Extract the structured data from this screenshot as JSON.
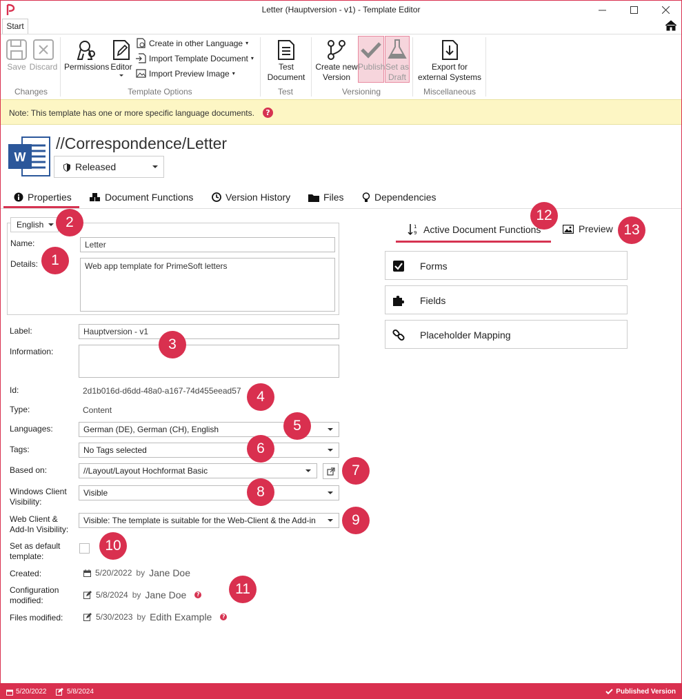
{
  "window": {
    "title": "Letter (Hauptversion - v1) - Template Editor",
    "minimize": "—",
    "maximize": "☐",
    "close": "✕"
  },
  "ribbon": {
    "tab_start": "Start",
    "save": "Save",
    "discard": "Discard",
    "group_changes": "Changes",
    "permissions": "Permissions",
    "editor": "Editor",
    "create_other_language": "Create in other Language",
    "import_template_document": "Import Template Document",
    "import_preview_image": "Import Preview Image",
    "group_template_options": "Template Options",
    "test_document_line1": "Test",
    "test_document_line2": "Document",
    "group_test": "Test",
    "create_new_version_line1": "Create new",
    "create_new_version_line2": "Version",
    "publish": "Publish",
    "set_as_draft_line1": "Set as",
    "set_as_draft_line2": "Draft",
    "group_versioning": "Versioning",
    "export_line1": "Export for",
    "export_line2": "external Systems",
    "group_misc": "Miscellaneous"
  },
  "note": {
    "text": "Note: This template has one or more specific language documents.",
    "help": "?"
  },
  "header": {
    "path": "//Correspondence/Letter",
    "status": "Released"
  },
  "tabs": {
    "properties": "Properties",
    "document_functions": "Document Functions",
    "version_history": "Version History",
    "files": "Files",
    "dependencies": "Dependencies"
  },
  "form": {
    "language": "English",
    "name_label": "Name:",
    "name_value": "Letter",
    "details_label": "Details:",
    "details_value": "Web app template for PrimeSoft letters",
    "label_label": "Label:",
    "label_value": "Hauptversion - v1",
    "information_label": "Information:",
    "information_value": "",
    "id_label": "Id:",
    "id_value": "2d1b016d-d6dd-48a0-a167-74d455eead57",
    "type_label": "Type:",
    "type_value": "Content",
    "languages_label": "Languages:",
    "languages_value": "German (DE), German (CH), English",
    "tags_label": "Tags:",
    "tags_value": "No Tags selected",
    "based_on_label": "Based on:",
    "based_on_value": "//Layout/Layout Hochformat Basic",
    "windows_vis_label_line1": "Windows Client",
    "windows_vis_label_line2": "Visibility:",
    "windows_vis_value": "Visible",
    "web_vis_label_line1": "Web Client &",
    "web_vis_label_line2": "Add-In Visibility:",
    "web_vis_value": "Visible: The template is suitable for the Web-Client & the Add-in",
    "default_label_line1": "Set as default",
    "default_label_line2": "template:",
    "default_checked": false,
    "created_label": "Created:",
    "created_date": "5/20/2022",
    "created_by": "by",
    "created_user": "Jane Doe",
    "config_label_line1": "Configuration",
    "config_label_line2": "modified:",
    "config_date": "5/8/2024",
    "config_by": "by",
    "config_user": "Jane Doe",
    "files_label": "Files modified:",
    "files_date": "5/30/2023",
    "files_by": "by",
    "files_user": "Edith Example",
    "help": "?"
  },
  "right_panel": {
    "tab_active_functions": "Active Document Functions",
    "tab_preview": "Preview",
    "functions": [
      {
        "label": "Forms",
        "icon": "checkbox-icon"
      },
      {
        "label": "Fields",
        "icon": "puzzle-icon"
      },
      {
        "label": "Placeholder Mapping",
        "icon": "link-icon"
      }
    ]
  },
  "badges": [
    "1",
    "2",
    "3",
    "4",
    "5",
    "6",
    "7",
    "8",
    "9",
    "10",
    "11",
    "12",
    "13"
  ],
  "statusbar": {
    "created": "5/20/2022",
    "modified": "5/8/2024",
    "published": "Published Version"
  },
  "colors": {
    "accent": "#d9304f",
    "note_bg": "#fdf6c4",
    "word_blue": "#2b579a"
  }
}
